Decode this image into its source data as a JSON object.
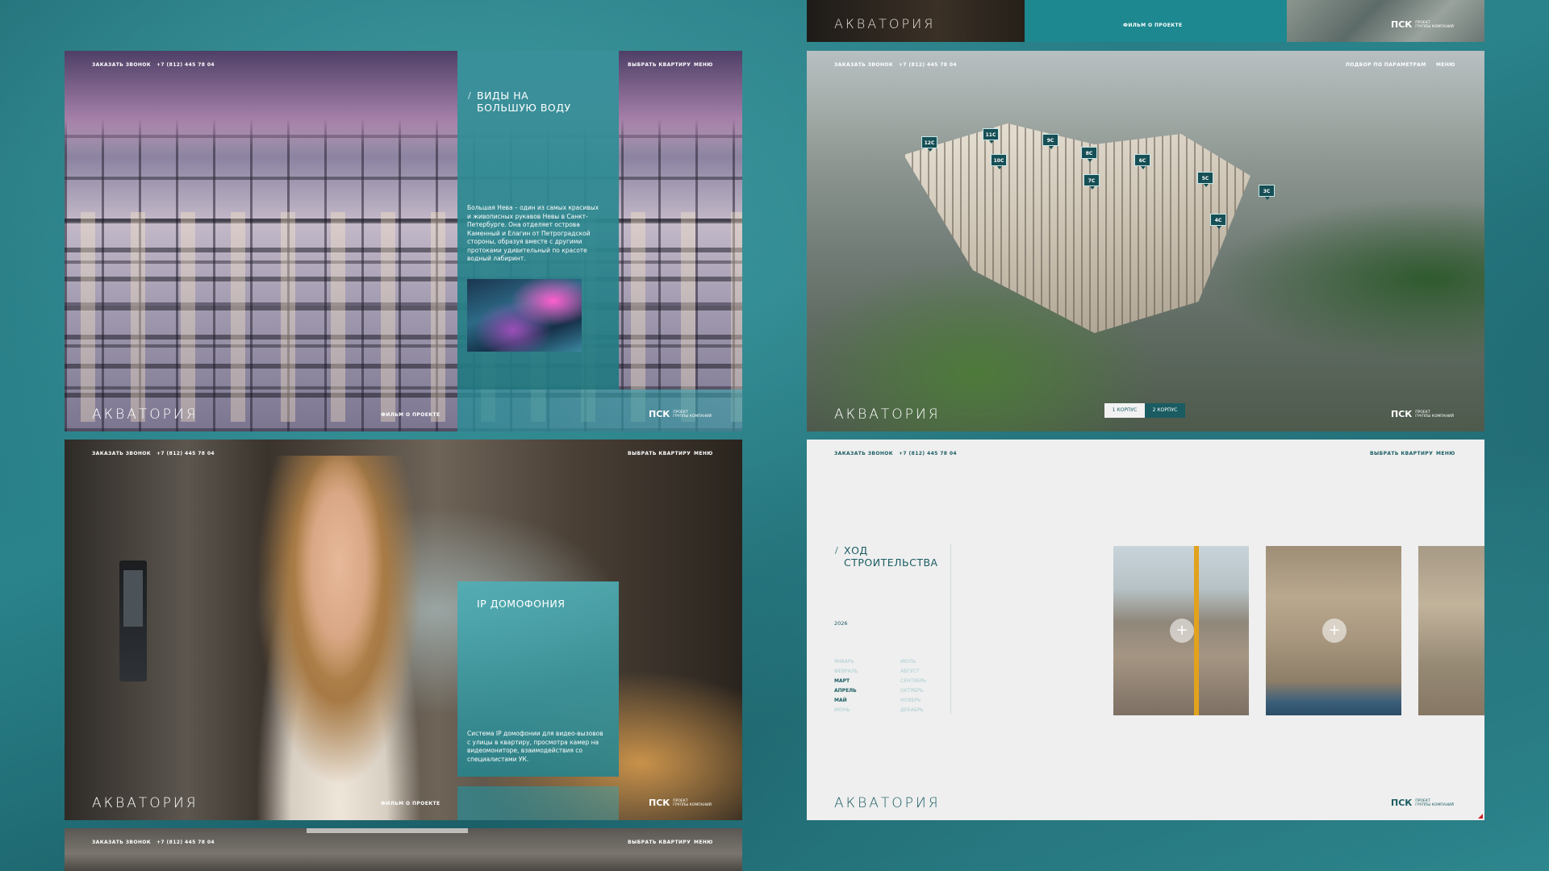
{
  "nav": {
    "call": "ЗАКАЗАТЬ ЗВОНОК",
    "phone": "+7 (812) 445 78 04",
    "choose": "ВЫБРАТЬ КВАРТИРУ",
    "menu": "МЕНЮ",
    "params": "ПОДБОР ПО ПАРАМЕТРАМ"
  },
  "brand": {
    "logo": "АКВАТОРИЯ",
    "film": "ФИЛЬМ О ПРОЕКТЕ",
    "psk": "ПСК",
    "psk_sub1": "ПРОЕКТ",
    "psk_sub2": "ГРУППЫ КОМПАНИЙ"
  },
  "views": {
    "title_l1": "ВИДЫ НА",
    "title_l2": "БОЛЬШУЮ ВОДУ",
    "text": "Большая Нева – один из самых красивых и живописных рукавов Невы в Санкт-Петербурге. Она отделяет острова Каменный и Елагин от Петроградской стороны, образуя вместе с другими протоками удивительный по красоте водный лабиринт."
  },
  "aerial": {
    "pins": [
      "12С",
      "11С",
      "9С",
      "10С",
      "8С",
      "6С",
      "7С",
      "5С",
      "3С",
      "4С"
    ],
    "btn1": "1 КОРПУС",
    "btn2": "2 КОРПУС"
  },
  "intercom": {
    "title": "IP ДОМОФОНИЯ",
    "text": "Система IP домофонии для видео-вызовов с улицы в квартиру, просмотра камер на видеомониторе, взаимодействия со специалистами УК."
  },
  "construction": {
    "title_l1": "ХОД",
    "title_l2": "СТРОИТЕЛЬСТВА",
    "year": "2026",
    "months_left": [
      "ЯНВАРЬ",
      "ФЕВРАЛЬ",
      "МАРТ",
      "АПРЕЛЬ",
      "МАЙ",
      "ИЮНЬ"
    ],
    "months_right": [
      "ИЮЛЬ",
      "АВГУСТ",
      "СЕНТЯБРЬ",
      "ОКТЯБРЬ",
      "НОЯБРЬ",
      "ДЕКАБРЬ"
    ],
    "active_months": [
      "МАРТ",
      "АПРЕЛЬ",
      "МАЙ"
    ]
  },
  "colors": {
    "brand_teal": "#1a5c62",
    "card_teal": "#2b868e",
    "bg_teal": "#247a82"
  }
}
